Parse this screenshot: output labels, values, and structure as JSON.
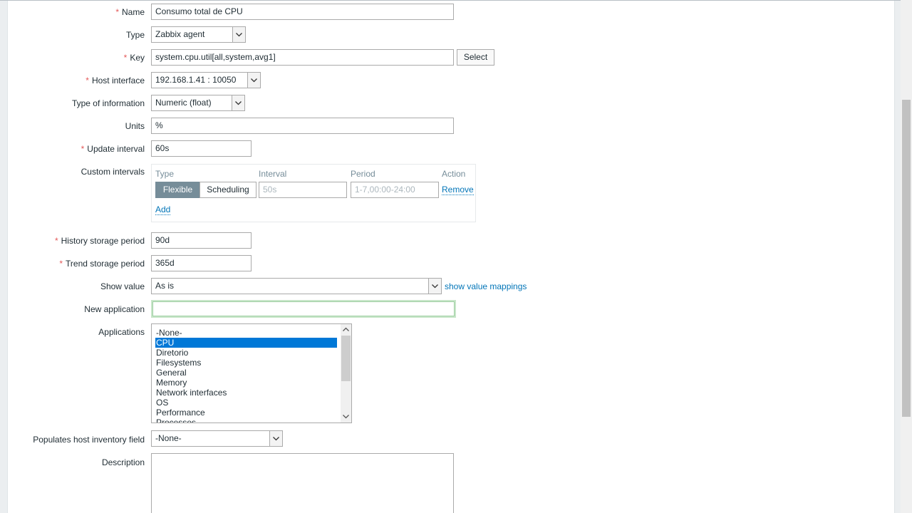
{
  "form": {
    "name": {
      "label": "Name",
      "value": "Consumo total de CPU"
    },
    "type": {
      "label": "Type",
      "value": "Zabbix agent"
    },
    "key": {
      "label": "Key",
      "value": "system.cpu.util[all,system,avg1]",
      "button": "Select"
    },
    "host_interface": {
      "label": "Host interface",
      "value": "192.168.1.41 : 10050"
    },
    "type_of_information": {
      "label": "Type of information",
      "value": "Numeric (float)"
    },
    "units": {
      "label": "Units",
      "value": "%"
    },
    "update_interval": {
      "label": "Update interval",
      "value": "60s"
    },
    "custom_intervals": {
      "label": "Custom intervals",
      "headers": {
        "type": "Type",
        "interval": "Interval",
        "period": "Period",
        "action": "Action"
      },
      "row": {
        "flexible": "Flexible",
        "scheduling": "Scheduling",
        "interval_placeholder": "50s",
        "period_placeholder": "1-7,00:00-24:00",
        "remove": "Remove"
      },
      "add": "Add"
    },
    "history": {
      "label": "History storage period",
      "value": "90d"
    },
    "trend": {
      "label": "Trend storage period",
      "value": "365d"
    },
    "show_value": {
      "label": "Show value",
      "value": "As is",
      "link": "show value mappings"
    },
    "new_application": {
      "label": "New application",
      "value": ""
    },
    "applications": {
      "label": "Applications",
      "options": [
        "-None-",
        "CPU",
        "Diretorio",
        "Filesystems",
        "General",
        "Memory",
        "Network interfaces",
        "OS",
        "Performance",
        "Processes"
      ],
      "selected": "CPU"
    },
    "inventory": {
      "label": "Populates host inventory field",
      "value": "-None-"
    },
    "description": {
      "label": "Description",
      "value": ""
    },
    "required_mark": "*"
  },
  "colors": {
    "required": "#e45959",
    "link": "#0275b8",
    "selected": "#0078d7",
    "toggle_active": "#768d99"
  }
}
